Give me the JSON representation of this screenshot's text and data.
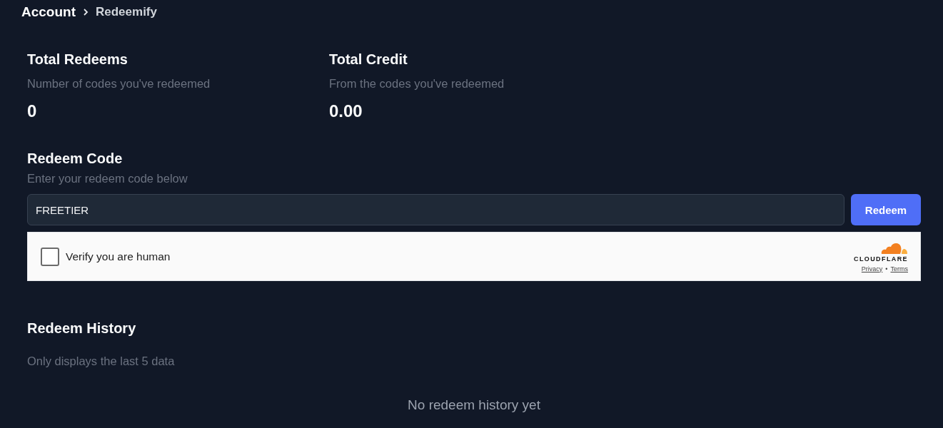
{
  "breadcrumb": {
    "parent": "Account",
    "current": "Redeemify"
  },
  "stats": [
    {
      "title": "Total Redeems",
      "subtitle": "Number of codes you've redeemed",
      "value": "0"
    },
    {
      "title": "Total Credit",
      "subtitle": "From the codes you've redeemed",
      "value": "0.00"
    }
  ],
  "redeem": {
    "title": "Redeem Code",
    "subtitle": "Enter your redeem code below",
    "code_field": {
      "value": "FREETIER"
    },
    "button": "Redeem"
  },
  "captcha": {
    "label": "Verify you are human",
    "checked": false,
    "brand": "CLOUDFLARE",
    "links": [
      "Privacy",
      "Terms"
    ],
    "separator": "•"
  },
  "history": {
    "title": "Redeem History",
    "subtitle": "Only displays the last 5 data",
    "empty_message": "No redeem history yet"
  }
}
